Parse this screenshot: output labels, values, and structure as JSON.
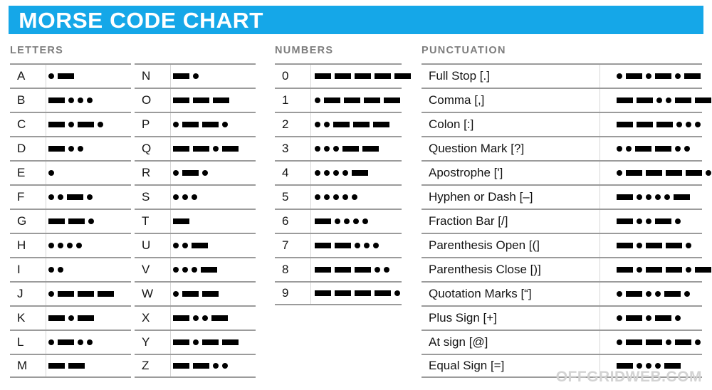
{
  "header": {
    "title": "MORSE CODE CHART",
    "bar_color": "#15a7e8",
    "title_color": "#ffffff"
  },
  "sections": {
    "letters_heading": "LETTERS",
    "numbers_heading": "NUMBERS",
    "punctuation_heading": "PUNCTUATION",
    "heading_color": "#7d7d7d"
  },
  "symbols": {
    "dot": "dot",
    "dash": "dash",
    "color": "#000000"
  },
  "letters_column_1": [
    {
      "label": "A",
      "code": [
        "dot",
        "dash"
      ]
    },
    {
      "label": "B",
      "code": [
        "dash",
        "dot",
        "dot",
        "dot"
      ]
    },
    {
      "label": "C",
      "code": [
        "dash",
        "dot",
        "dash",
        "dot"
      ]
    },
    {
      "label": "D",
      "code": [
        "dash",
        "dot",
        "dot"
      ]
    },
    {
      "label": "E",
      "code": [
        "dot"
      ]
    },
    {
      "label": "F",
      "code": [
        "dot",
        "dot",
        "dash",
        "dot"
      ]
    },
    {
      "label": "G",
      "code": [
        "dash",
        "dash",
        "dot"
      ]
    },
    {
      "label": "H",
      "code": [
        "dot",
        "dot",
        "dot",
        "dot"
      ]
    },
    {
      "label": "I",
      "code": [
        "dot",
        "dot"
      ]
    },
    {
      "label": "J",
      "code": [
        "dot",
        "dash",
        "dash",
        "dash"
      ]
    },
    {
      "label": "K",
      "code": [
        "dash",
        "dot",
        "dash"
      ]
    },
    {
      "label": "L",
      "code": [
        "dot",
        "dash",
        "dot",
        "dot"
      ]
    },
    {
      "label": "M",
      "code": [
        "dash",
        "dash"
      ]
    }
  ],
  "letters_column_2": [
    {
      "label": "N",
      "code": [
        "dash",
        "dot"
      ]
    },
    {
      "label": "O",
      "code": [
        "dash",
        "dash",
        "dash"
      ]
    },
    {
      "label": "P",
      "code": [
        "dot",
        "dash",
        "dash",
        "dot"
      ]
    },
    {
      "label": "Q",
      "code": [
        "dash",
        "dash",
        "dot",
        "dash"
      ]
    },
    {
      "label": "R",
      "code": [
        "dot",
        "dash",
        "dot"
      ]
    },
    {
      "label": "S",
      "code": [
        "dot",
        "dot",
        "dot"
      ]
    },
    {
      "label": "T",
      "code": [
        "dash"
      ]
    },
    {
      "label": "U",
      "code": [
        "dot",
        "dot",
        "dash"
      ]
    },
    {
      "label": "V",
      "code": [
        "dot",
        "dot",
        "dot",
        "dash"
      ]
    },
    {
      "label": "W",
      "code": [
        "dot",
        "dash",
        "dash"
      ]
    },
    {
      "label": "X",
      "code": [
        "dash",
        "dot",
        "dot",
        "dash"
      ]
    },
    {
      "label": "Y",
      "code": [
        "dash",
        "dot",
        "dash",
        "dash"
      ]
    },
    {
      "label": "Z",
      "code": [
        "dash",
        "dash",
        "dot",
        "dot"
      ]
    }
  ],
  "numbers": [
    {
      "label": "0",
      "code": [
        "dash",
        "dash",
        "dash",
        "dash",
        "dash"
      ]
    },
    {
      "label": "1",
      "code": [
        "dot",
        "dash",
        "dash",
        "dash",
        "dash"
      ]
    },
    {
      "label": "2",
      "code": [
        "dot",
        "dot",
        "dash",
        "dash",
        "dash"
      ]
    },
    {
      "label": "3",
      "code": [
        "dot",
        "dot",
        "dot",
        "dash",
        "dash"
      ]
    },
    {
      "label": "4",
      "code": [
        "dot",
        "dot",
        "dot",
        "dot",
        "dash"
      ]
    },
    {
      "label": "5",
      "code": [
        "dot",
        "dot",
        "dot",
        "dot",
        "dot"
      ]
    },
    {
      "label": "6",
      "code": [
        "dash",
        "dot",
        "dot",
        "dot",
        "dot"
      ]
    },
    {
      "label": "7",
      "code": [
        "dash",
        "dash",
        "dot",
        "dot",
        "dot"
      ]
    },
    {
      "label": "8",
      "code": [
        "dash",
        "dash",
        "dash",
        "dot",
        "dot"
      ]
    },
    {
      "label": "9",
      "code": [
        "dash",
        "dash",
        "dash",
        "dash",
        "dot"
      ]
    }
  ],
  "punctuation": [
    {
      "label": "Full Stop [.]",
      "code": [
        "dot",
        "dash",
        "dot",
        "dash",
        "dot",
        "dash"
      ]
    },
    {
      "label": "Comma [,]",
      "code": [
        "dash",
        "dash",
        "dot",
        "dot",
        "dash",
        "dash"
      ]
    },
    {
      "label": "Colon [:]",
      "code": [
        "dash",
        "dash",
        "dash",
        "dot",
        "dot",
        "dot"
      ]
    },
    {
      "label": "Question Mark [?]",
      "code": [
        "dot",
        "dot",
        "dash",
        "dash",
        "dot",
        "dot"
      ]
    },
    {
      "label": "Apostrophe [']",
      "code": [
        "dot",
        "dash",
        "dash",
        "dash",
        "dash",
        "dot"
      ]
    },
    {
      "label": "Hyphen or Dash [–]",
      "code": [
        "dash",
        "dot",
        "dot",
        "dot",
        "dot",
        "dash"
      ]
    },
    {
      "label": "Fraction Bar [/]",
      "code": [
        "dash",
        "dot",
        "dot",
        "dash",
        "dot"
      ]
    },
    {
      "label": "Parenthesis Open [(]",
      "code": [
        "dash",
        "dot",
        "dash",
        "dash",
        "dot"
      ]
    },
    {
      "label": "Parenthesis Close [)]",
      "code": [
        "dash",
        "dot",
        "dash",
        "dash",
        "dot",
        "dash"
      ]
    },
    {
      "label": "Quotation Marks [“]",
      "code": [
        "dot",
        "dash",
        "dot",
        "dot",
        "dash",
        "dot"
      ]
    },
    {
      "label": "Plus Sign [+]",
      "code": [
        "dot",
        "dash",
        "dot",
        "dash",
        "dot"
      ]
    },
    {
      "label": "At sign [@]",
      "code": [
        "dot",
        "dash",
        "dash",
        "dot",
        "dash",
        "dot"
      ]
    },
    {
      "label": "Equal Sign [=]",
      "code": [
        "dash",
        "dot",
        "dot",
        "dot",
        "dash"
      ]
    }
  ],
  "watermark": {
    "text": "OFFGRIDWEB.COM",
    "color": "#d3d3d3"
  }
}
